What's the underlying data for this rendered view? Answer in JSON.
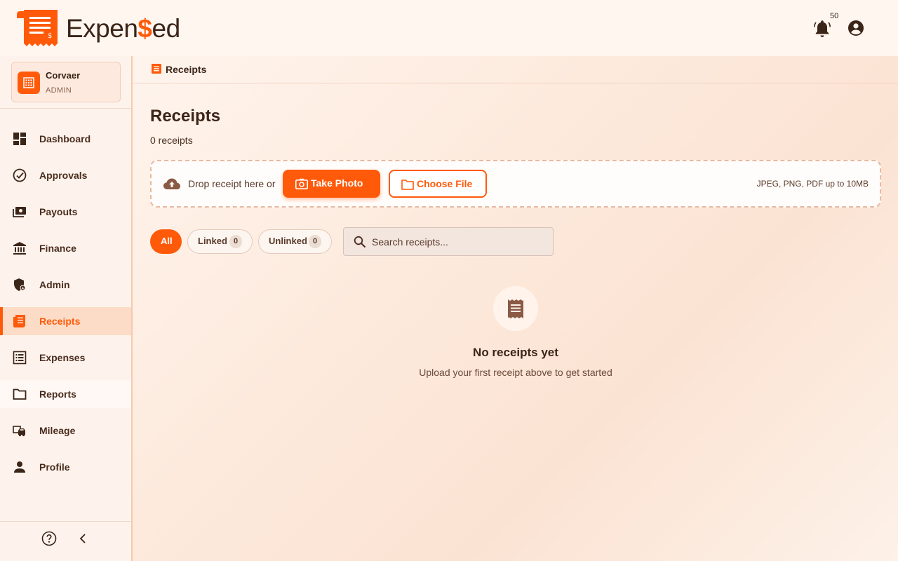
{
  "header": {
    "brand_prefix": "Expen",
    "brand_dollar": "$",
    "brand_suffix": "ed",
    "notification_count": "50",
    "bell_icon": "bell-icon",
    "account_icon": "account-circle-icon"
  },
  "sidebar": {
    "org": {
      "name": "Corvaer",
      "role": "ADMIN"
    },
    "items": [
      {
        "label": "Dashboard",
        "icon": "dashboard-icon"
      },
      {
        "label": "Approvals",
        "icon": "check-circle-icon"
      },
      {
        "label": "Payouts",
        "icon": "payments-icon"
      },
      {
        "label": "Finance",
        "icon": "bank-icon"
      },
      {
        "label": "Admin",
        "icon": "admin-shield-icon"
      },
      {
        "label": "Receipts",
        "icon": "receipt-icon",
        "active": true
      },
      {
        "label": "Expenses",
        "icon": "list-icon"
      },
      {
        "label": "Reports",
        "icon": "folder-icon"
      },
      {
        "label": "Mileage",
        "icon": "car-icon"
      },
      {
        "label": "Profile",
        "icon": "person-icon"
      }
    ],
    "help_icon": "help-circle-icon",
    "collapse_icon": "chevron-left-icon"
  },
  "breadcrumb": {
    "label": "Receipts"
  },
  "main": {
    "title": "Receipts",
    "count_text": "0 receipts",
    "dropzone": {
      "text": "Drop receipt here or",
      "take_photo": "Take Photo",
      "choose_file": "Choose File",
      "formats": "JPEG, PNG, PDF up to 10MB"
    },
    "filters": {
      "all": "All",
      "linked": "Linked",
      "linked_count": "0",
      "unlinked": "Unlinked",
      "unlinked_count": "0"
    },
    "search": {
      "placeholder": "Search receipts...",
      "value": ""
    },
    "empty": {
      "title": "No receipts yet",
      "subtitle": "Upload your first receipt above to get started"
    }
  },
  "colors": {
    "accent": "#ff5a0a",
    "text": "#3b2418",
    "sidebar_active_bg": "#fcdcc7"
  }
}
